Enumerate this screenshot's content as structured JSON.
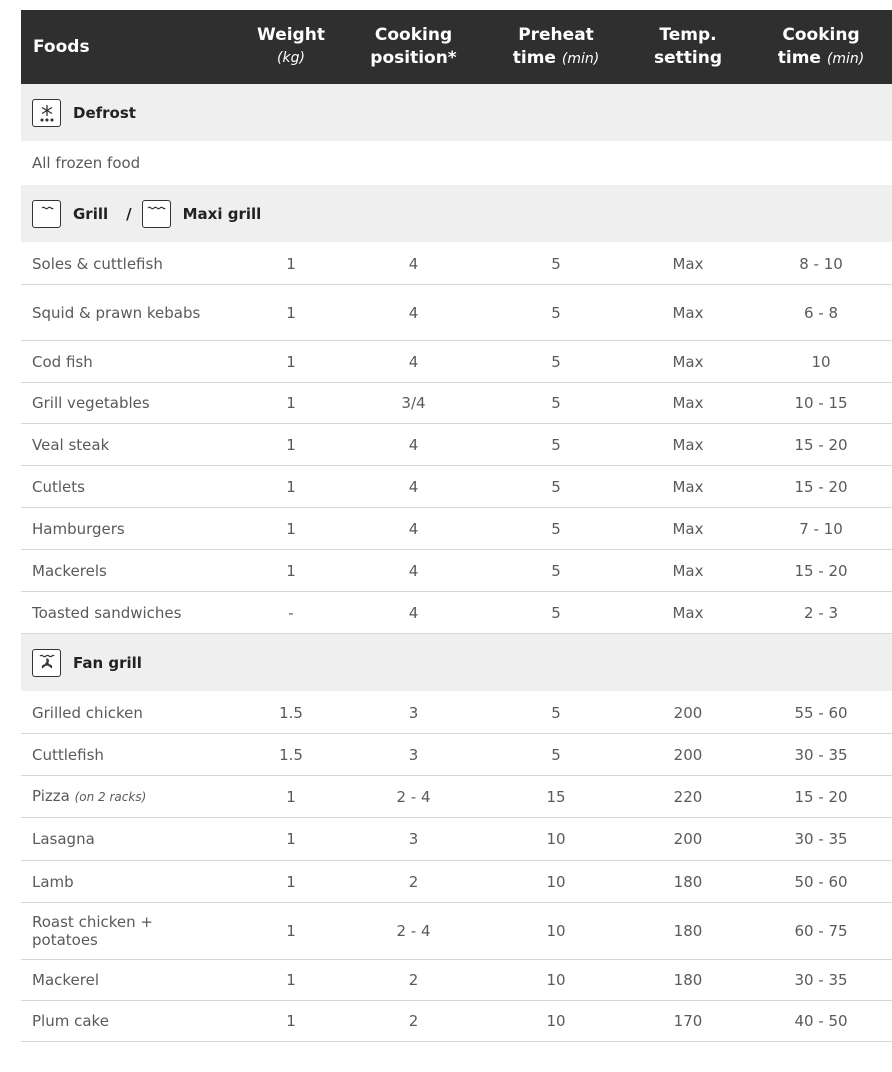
{
  "header": {
    "foods": "Foods",
    "weight": "Weight",
    "weight_unit": "(kg)",
    "position_line1": "Cooking",
    "position_line2": "position*",
    "preheat_line1": "Preheat",
    "preheat_line2": "time",
    "preheat_unit": "(min)",
    "temp_line1": "Temp.",
    "temp_line2": "setting",
    "time_line1": "Cooking",
    "time_line2": "time",
    "time_unit": "(min)"
  },
  "sections": {
    "defrost": {
      "title": "Defrost",
      "icon": "snowflake-icon",
      "note": "All frozen food"
    },
    "grill": {
      "title": "Grill",
      "separator": "/",
      "title2": "Maxi grill",
      "icon": "grill-icon",
      "icon2": "maxi-grill-icon",
      "rows": [
        {
          "food": "Soles & cuttlefish",
          "weight": "1",
          "position": "4",
          "preheat": "5",
          "temp": "Max",
          "time": "8 - 10"
        },
        {
          "food": "Squid & prawn kebabs",
          "weight": "1",
          "position": "4",
          "preheat": "5",
          "temp": "Max",
          "time": "6 - 8"
        },
        {
          "food": "Cod fish",
          "weight": "1",
          "position": "4",
          "preheat": "5",
          "temp": "Max",
          "time": "10"
        },
        {
          "food": "Grill vegetables",
          "weight": "1",
          "position": "3/4",
          "preheat": "5",
          "temp": "Max",
          "time": "10 - 15"
        },
        {
          "food": "Veal steak",
          "weight": "1",
          "position": "4",
          "preheat": "5",
          "temp": "Max",
          "time": "15 - 20"
        },
        {
          "food": "Cutlets",
          "weight": "1",
          "position": "4",
          "preheat": "5",
          "temp": "Max",
          "time": "15 - 20"
        },
        {
          "food": "Hamburgers",
          "weight": "1",
          "position": "4",
          "preheat": "5",
          "temp": "Max",
          "time": "7 - 10"
        },
        {
          "food": "Mackerels",
          "weight": "1",
          "position": "4",
          "preheat": "5",
          "temp": "Max",
          "time": "15 - 20"
        },
        {
          "food": "Toasted sandwiches",
          "weight": "-",
          "position": "4",
          "preheat": "5",
          "temp": "Max",
          "time": "2 - 3"
        }
      ]
    },
    "fan_grill": {
      "title": "Fan grill",
      "icon": "fan-grill-icon",
      "rows": [
        {
          "food": "Grilled chicken",
          "weight": "1.5",
          "position": "3",
          "preheat": "5",
          "temp": "200",
          "time": "55 - 60"
        },
        {
          "food": "Cuttlefish",
          "weight": "1.5",
          "position": "3",
          "preheat": "5",
          "temp": "200",
          "time": "30 - 35"
        },
        {
          "food": "Pizza",
          "food_note": "(on 2 racks)",
          "weight": "1",
          "position": "2 - 4",
          "preheat": "15",
          "temp": "220",
          "time": "15 - 20"
        },
        {
          "food": "Lasagna",
          "weight": "1",
          "position": "3",
          "preheat": "10",
          "temp": "200",
          "time": "30 - 35"
        },
        {
          "food": "Lamb",
          "weight": "1",
          "position": "2",
          "preheat": "10",
          "temp": "180",
          "time": "50 - 60"
        },
        {
          "food": "Roast chicken + potatoes",
          "weight": "1",
          "position": "2 - 4",
          "preheat": "10",
          "temp": "180",
          "time": "60 - 75"
        },
        {
          "food": "Mackerel",
          "weight": "1",
          "position": "2",
          "preheat": "10",
          "temp": "180",
          "time": "30 - 35"
        },
        {
          "food": "Plum cake",
          "weight": "1",
          "position": "2",
          "preheat": "10",
          "temp": "170",
          "time": "40 - 50"
        }
      ]
    }
  }
}
